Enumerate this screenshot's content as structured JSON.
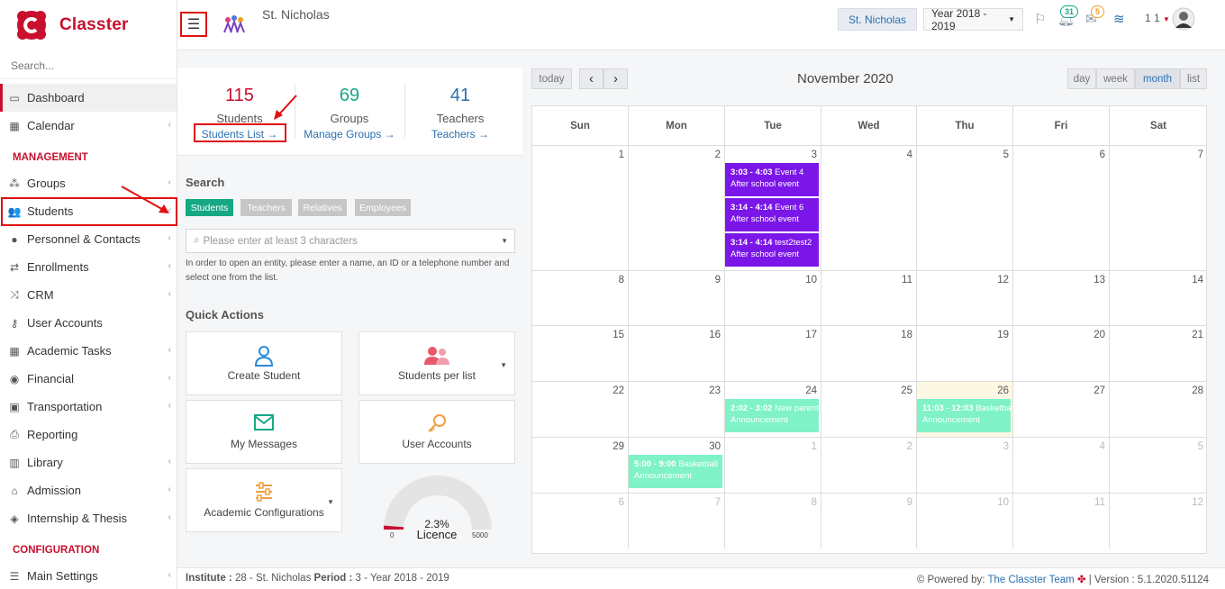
{
  "brand": {
    "name": "Classter",
    "color": "#c8102e"
  },
  "sidebar": {
    "search_placeholder": "Search...",
    "items": [
      {
        "label": "Dashboard",
        "icon": "laptop-icon"
      },
      {
        "label": "Calendar",
        "icon": "calendar-icon"
      },
      {
        "label": "Groups",
        "icon": "groups-icon"
      },
      {
        "label": "Students",
        "icon": "students-icon"
      },
      {
        "label": "Personnel & Contacts",
        "icon": "user-icon"
      },
      {
        "label": "Enrollments",
        "icon": "swap-icon"
      },
      {
        "label": "CRM",
        "icon": "shuffle-icon"
      },
      {
        "label": "User Accounts",
        "icon": "key-icon"
      },
      {
        "label": "Academic Tasks",
        "icon": "grid-icon"
      },
      {
        "label": "Financial",
        "icon": "coins-icon"
      },
      {
        "label": "Transportation",
        "icon": "bus-icon"
      },
      {
        "label": "Reporting",
        "icon": "printer-icon"
      },
      {
        "label": "Library",
        "icon": "books-icon"
      },
      {
        "label": "Admission",
        "icon": "bank-icon"
      },
      {
        "label": "Internship & Thesis",
        "icon": "cube-icon"
      },
      {
        "label": "Main Settings",
        "icon": "sliders-icon"
      }
    ],
    "sections": {
      "management": "MANAGEMENT",
      "configuration": "CONFIGURATION"
    }
  },
  "header": {
    "school": "St. Nicholas",
    "school_button": "St. Nicholas",
    "year_select": "Year 2018 - 2019",
    "notif_count": "31",
    "mail_count": "5",
    "user_label": "1 1"
  },
  "stats": [
    {
      "value": "115",
      "label": "Students",
      "link": "Students List",
      "color": "#c8102e"
    },
    {
      "value": "69",
      "label": "Groups",
      "link": "Manage Groups",
      "color": "#16a885"
    },
    {
      "value": "41",
      "label": "Teachers",
      "link": "Teachers",
      "color": "#2a6fb0"
    }
  ],
  "search": {
    "title": "Search",
    "tags": [
      "Students",
      "Teachers",
      "Relatives",
      "Employees"
    ],
    "placeholder": "Please enter at least 3 characters",
    "hint": "In order to open an entity, please enter a name, an ID or a telephone number and select one from the list."
  },
  "quick_actions": {
    "title": "Quick Actions",
    "items": [
      {
        "label": "Create Student",
        "icon": "user-outline-icon"
      },
      {
        "label": "Students per list",
        "icon": "users-pink-icon"
      },
      {
        "label": "My Messages",
        "icon": "envelope-icon"
      },
      {
        "label": "User Accounts",
        "icon": "key-orange-icon"
      },
      {
        "label": "Academic Configurations",
        "icon": "sliders-orange-icon"
      }
    ]
  },
  "licence": {
    "percent": "2.3%",
    "label": "Licence",
    "min": "0",
    "max": "5000",
    "fraction": 0.023
  },
  "calendar": {
    "title": "November 2020",
    "buttons": {
      "today": "today",
      "prev": "‹",
      "next": "›",
      "day": "day",
      "week": "week",
      "month": "month",
      "list": "list"
    },
    "days": [
      "Sun",
      "Mon",
      "Tue",
      "Wed",
      "Thu",
      "Fri",
      "Sat"
    ],
    "weeks": [
      [
        [
          "1",
          0
        ],
        [
          "2",
          0
        ],
        [
          "3",
          0
        ],
        [
          "4",
          0
        ],
        [
          "5",
          0
        ],
        [
          "6",
          0
        ],
        [
          "7",
          0
        ]
      ],
      [
        [
          "8",
          0
        ],
        [
          "9",
          0
        ],
        [
          "10",
          0
        ],
        [
          "11",
          0
        ],
        [
          "12",
          0
        ],
        [
          "13",
          0
        ],
        [
          "14",
          0
        ]
      ],
      [
        [
          "15",
          0
        ],
        [
          "16",
          0
        ],
        [
          "17",
          0
        ],
        [
          "18",
          0
        ],
        [
          "19",
          0
        ],
        [
          "20",
          0
        ],
        [
          "21",
          0
        ]
      ],
      [
        [
          "22",
          0
        ],
        [
          "23",
          0
        ],
        [
          "24",
          0
        ],
        [
          "25",
          0
        ],
        [
          "26",
          0
        ],
        [
          "27",
          0
        ],
        [
          "28",
          0
        ]
      ],
      [
        [
          "29",
          0
        ],
        [
          "30",
          0
        ],
        [
          "1",
          1
        ],
        [
          "2",
          1
        ],
        [
          "3",
          1
        ],
        [
          "4",
          1
        ],
        [
          "5",
          1
        ]
      ],
      [
        [
          "6",
          1
        ],
        [
          "7",
          1
        ],
        [
          "8",
          1
        ],
        [
          "9",
          1
        ],
        [
          "10",
          1
        ],
        [
          "11",
          1
        ],
        [
          "12",
          1
        ]
      ]
    ],
    "events": [
      {
        "week": 0,
        "day": 2,
        "slot": 0,
        "time": "3:03 - 4:03",
        "title": "Event 4",
        "sub": "After school event",
        "color": "purple"
      },
      {
        "week": 0,
        "day": 2,
        "slot": 1,
        "time": "3:14 - 4:14",
        "title": "Event 6",
        "sub": "After school event",
        "color": "purple"
      },
      {
        "week": 0,
        "day": 2,
        "slot": 2,
        "time": "3:14 - 4:14",
        "title": "test2test2",
        "sub": "After school event",
        "color": "purple"
      },
      {
        "week": 3,
        "day": 2,
        "slot": 0,
        "time": "2:02 - 3:02",
        "title": "New parent",
        "sub": "Announcement",
        "color": "teal"
      },
      {
        "week": 3,
        "day": 4,
        "slot": 0,
        "time": "11:03 - 12:03",
        "title": "Basketball",
        "sub": "Announcement",
        "color": "teal"
      },
      {
        "week": 4,
        "day": 1,
        "slot": 0,
        "time": "5:00 - 9:00",
        "title": "Basketball",
        "sub": "Announcement",
        "color": "teal"
      }
    ]
  },
  "footer": {
    "institute_label": "Institute :",
    "institute_value": "28 - St. Nicholas",
    "period_label": "Period :",
    "period_value": "3 - Year 2018 - 2019",
    "powered": "Powered by:",
    "team": "The Classter Team",
    "version": "| Version : 5.1.2020.51124"
  }
}
